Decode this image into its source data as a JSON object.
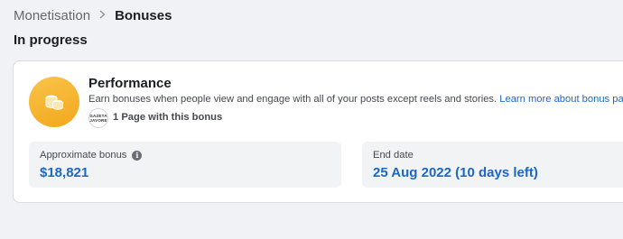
{
  "breadcrumb": {
    "parent": "Monetisation",
    "current": "Bonuses"
  },
  "section_title": "In progress",
  "bonus": {
    "icon": "coin-stack-icon",
    "title": "Performance",
    "description": "Earn bonuses when people view and engage with all of your posts except reels and stories.",
    "learn_more_link": "Learn more about bonus payouts.",
    "page_logo_line1": "GAZETA",
    "page_logo_line2": "JAVORE",
    "pages_text": "1 Page with this bonus",
    "approx_label": "Approximate bonus",
    "approx_value": "$18,821",
    "end_label": "End date",
    "end_value": "25 Aug 2022 (10 days left)"
  },
  "colors": {
    "accent": "#1b66c9",
    "coin": "#f5b52e",
    "background": "#f0f2f5"
  }
}
